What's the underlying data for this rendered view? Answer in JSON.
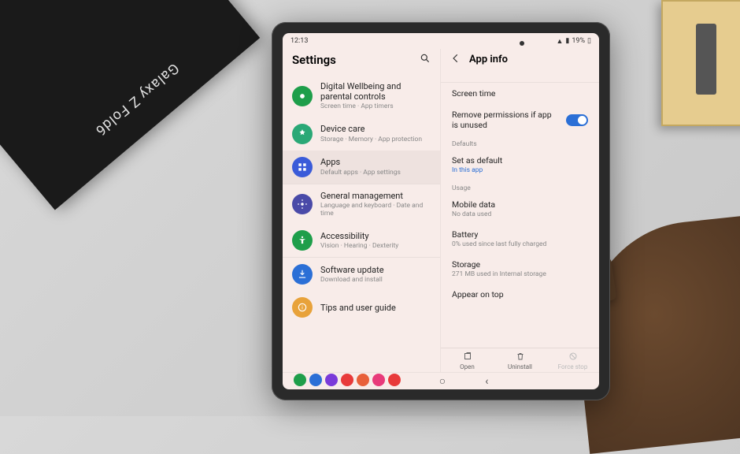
{
  "box_label": "Galaxy Z Fold6",
  "statusbar": {
    "time": "12:13",
    "battery_pct": "19%"
  },
  "left": {
    "title": "Settings",
    "items": [
      {
        "icon": "wellbeing",
        "color": "#1e9e4a",
        "title": "Digital Wellbeing and parental controls",
        "sub": "Screen time · App timers"
      },
      {
        "icon": "device-care",
        "color": "#2aa876",
        "title": "Device care",
        "sub": "Storage · Memory · App protection"
      },
      {
        "icon": "apps",
        "color": "#3a5bd9",
        "title": "Apps",
        "sub": "Default apps · App settings",
        "selected": true
      },
      {
        "icon": "general",
        "color": "#4a4aa8",
        "title": "General management",
        "sub": "Language and keyboard · Date and time",
        "sep": true
      },
      {
        "icon": "accessibility",
        "color": "#1e9e4a",
        "title": "Accessibility",
        "sub": "Vision · Hearing · Dexterity"
      },
      {
        "icon": "software-update",
        "color": "#2b6fd6",
        "title": "Software update",
        "sub": "Download and install",
        "sep": true
      },
      {
        "icon": "tips",
        "color": "#e8a23a",
        "title": "Tips and user guide",
        "sub": ""
      }
    ]
  },
  "right": {
    "title": "App info",
    "top_caption": "",
    "rows": [
      {
        "type": "item",
        "title": "Screen time",
        "sub": ""
      },
      {
        "type": "toggle",
        "title": "Remove permissions if app is unused",
        "on": true
      },
      {
        "type": "caption",
        "title": "Defaults"
      },
      {
        "type": "link",
        "title": "Set as default",
        "sub": "In this app"
      },
      {
        "type": "caption",
        "title": "Usage"
      },
      {
        "type": "item",
        "title": "Mobile data",
        "sub": "No data used"
      },
      {
        "type": "item",
        "title": "Battery",
        "sub": "0% used since last fully charged"
      },
      {
        "type": "item",
        "title": "Storage",
        "sub": "271 MB used in Internal storage"
      },
      {
        "type": "item",
        "title": "Appear on top",
        "sub": ""
      }
    ],
    "actions": [
      {
        "label": "Open",
        "icon": "open",
        "disabled": false
      },
      {
        "label": "Uninstall",
        "icon": "trash",
        "disabled": false
      },
      {
        "label": "Force stop",
        "icon": "stop",
        "disabled": true
      }
    ]
  },
  "dock_colors": [
    "#1e9e4a",
    "#2b6fd6",
    "#7a3ad9",
    "#e83a3a",
    "#e8603a",
    "#e83a7a",
    "#e83a3a"
  ]
}
